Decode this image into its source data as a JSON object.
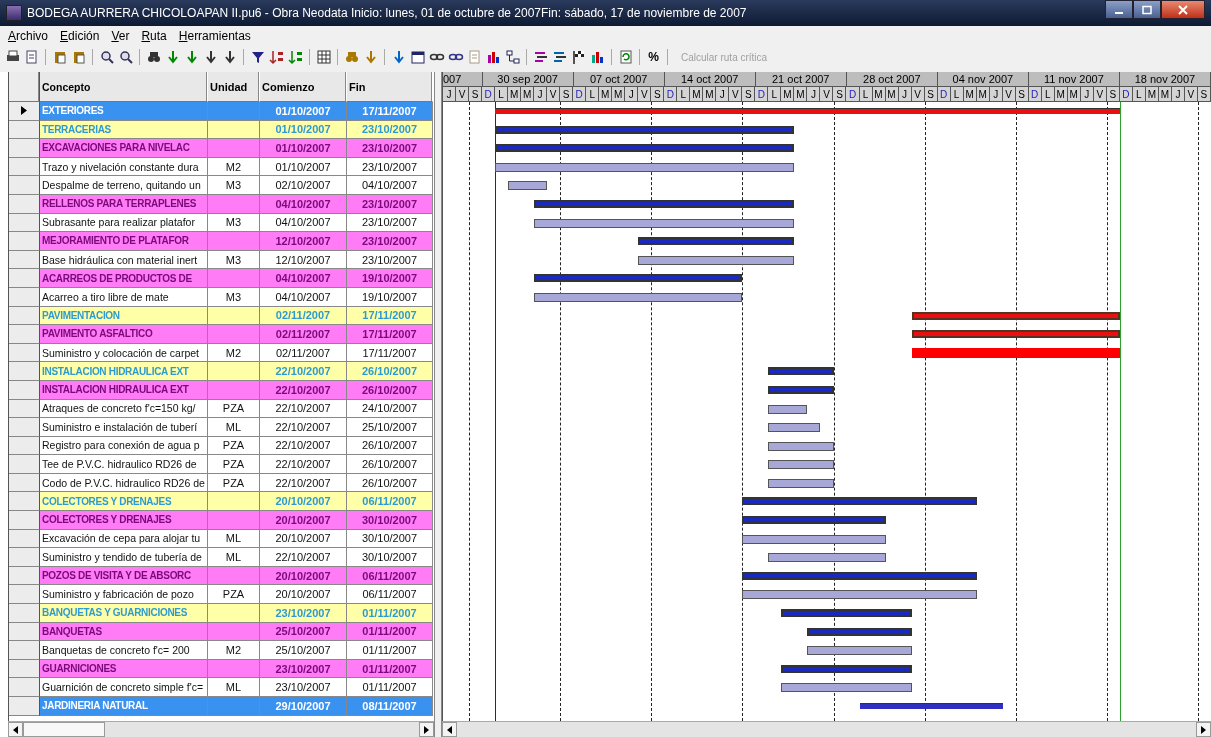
{
  "window": {
    "title": "BODEGA AURRERA CHICOLOAPAN II.pu6 - Obra Neodata Inicio: lunes, 01 de octubre de 2007Fin: sábado, 17 de noviembre de 2007"
  },
  "menu": [
    "Archivo",
    "Edición",
    "Ver",
    "Ruta",
    "Herramientas"
  ],
  "toolbar": {
    "percent": "%",
    "critical_path": {
      "label": "Calcular ruta crítica",
      "disabled": true
    }
  },
  "table": {
    "columns": [
      "Concepto",
      "Unidad",
      "Comienzo",
      "Fin"
    ],
    "rows": [
      {
        "kind": "top",
        "concept": "EXTERIORES",
        "unit": "",
        "start": "01/10/2007",
        "end": "17/11/2007",
        "critical": true,
        "selected": true
      },
      {
        "kind": "group",
        "concept": "TERRACERIAS",
        "unit": "",
        "start": "01/10/2007",
        "end": "23/10/2007",
        "critical": false,
        "selected": false
      },
      {
        "kind": "subgroup",
        "concept": "EXCAVACIONES PARA NIVELAC",
        "unit": "",
        "start": "01/10/2007",
        "end": "23/10/2007",
        "critical": false,
        "selected": false
      },
      {
        "kind": "task",
        "concept": "Trazo y nivelación constante dura",
        "unit": "M2",
        "start": "01/10/2007",
        "end": "23/10/2007",
        "critical": false,
        "selected": false
      },
      {
        "kind": "task",
        "concept": "Despalme de terreno, quitando un",
        "unit": "M3",
        "start": "02/10/2007",
        "end": "04/10/2007",
        "critical": false,
        "selected": false
      },
      {
        "kind": "subgroup",
        "concept": "RELLENOS PARA TERRAPLENES",
        "unit": "",
        "start": "04/10/2007",
        "end": "23/10/2007",
        "critical": false,
        "selected": false
      },
      {
        "kind": "task",
        "concept": "Subrasante para realizar platafor",
        "unit": "M3",
        "start": "04/10/2007",
        "end": "23/10/2007",
        "critical": false,
        "selected": false
      },
      {
        "kind": "subgroup",
        "concept": "MEJORAMIENTO DE PLATAFOR",
        "unit": "",
        "start": "12/10/2007",
        "end": "23/10/2007",
        "critical": false,
        "selected": false
      },
      {
        "kind": "task",
        "concept": " Base hidráulica con material inert",
        "unit": "M3",
        "start": "12/10/2007",
        "end": "23/10/2007",
        "critical": false,
        "selected": false
      },
      {
        "kind": "subgroup",
        "concept": "ACARREOS DE PRODUCTOS DE",
        "unit": "",
        "start": "04/10/2007",
        "end": "19/10/2007",
        "critical": false,
        "selected": false
      },
      {
        "kind": "task",
        "concept": "Acarreo a tiro libre de mate",
        "unit": "M3",
        "start": "04/10/2007",
        "end": "19/10/2007",
        "critical": false,
        "selected": false
      },
      {
        "kind": "group",
        "concept": "PAVIMENTACION",
        "unit": "",
        "start": "02/11/2007",
        "end": "17/11/2007",
        "critical": true,
        "selected": false
      },
      {
        "kind": "subgroup",
        "concept": "PAVIMENTO ASFALTICO",
        "unit": "",
        "start": "02/11/2007",
        "end": "17/11/2007",
        "critical": true,
        "selected": false
      },
      {
        "kind": "task",
        "concept": "Suministro y colocación de carpet",
        "unit": "M2",
        "start": "02/11/2007",
        "end": "17/11/2007",
        "critical": true,
        "selected": false
      },
      {
        "kind": "group",
        "concept": "INSTALACION HIDRAULICA EXT",
        "unit": "",
        "start": "22/10/2007",
        "end": "26/10/2007",
        "critical": false,
        "selected": false
      },
      {
        "kind": "subgroup",
        "concept": "INSTALACION HIDRAULICA EXT",
        "unit": "",
        "start": "22/10/2007",
        "end": "26/10/2007",
        "critical": false,
        "selected": false
      },
      {
        "kind": "task",
        "concept": "Atraques de concreto f'c=150 kg/",
        "unit": "PZA",
        "start": "22/10/2007",
        "end": "24/10/2007",
        "critical": false,
        "selected": false
      },
      {
        "kind": "task",
        "concept": " Suministro e instalación de tuberí",
        "unit": "ML",
        "start": "22/10/2007",
        "end": "25/10/2007",
        "critical": false,
        "selected": false
      },
      {
        "kind": "task",
        "concept": "Registro para conexión de agua p",
        "unit": "PZA",
        "start": "22/10/2007",
        "end": "26/10/2007",
        "critical": false,
        "selected": false
      },
      {
        "kind": "task",
        "concept": "Tee de P.V.C. hidraulico RD26 de",
        "unit": "PZA",
        "start": "22/10/2007",
        "end": "26/10/2007",
        "critical": false,
        "selected": false
      },
      {
        "kind": "task",
        "concept": "Codo de P.V.C. hidraulico RD26 de",
        "unit": "PZA",
        "start": "22/10/2007",
        "end": "26/10/2007",
        "critical": false,
        "selected": false
      },
      {
        "kind": "group",
        "concept": "COLECTORES Y DRENAJES",
        "unit": "",
        "start": "20/10/2007",
        "end": "06/11/2007",
        "critical": false,
        "selected": false
      },
      {
        "kind": "subgroup",
        "concept": "COLECTORES Y DRENAJES",
        "unit": "",
        "start": "20/10/2007",
        "end": "30/10/2007",
        "critical": false,
        "selected": false
      },
      {
        "kind": "task",
        "concept": "Excavación de cepa para alojar tu",
        "unit": "ML",
        "start": "20/10/2007",
        "end": "30/10/2007",
        "critical": false,
        "selected": false
      },
      {
        "kind": "task",
        "concept": "Suministro y tendido de tubería de",
        "unit": "ML",
        "start": "22/10/2007",
        "end": "30/10/2007",
        "critical": false,
        "selected": false
      },
      {
        "kind": "subgroup",
        "concept": "POZOS DE VISITA Y DE ABSORC",
        "unit": "",
        "start": "20/10/2007",
        "end": "06/11/2007",
        "critical": false,
        "selected": false
      },
      {
        "kind": "task",
        "concept": "Suministro y fabricación de pozo",
        "unit": "PZA",
        "start": "20/10/2007",
        "end": "06/11/2007",
        "critical": false,
        "selected": false
      },
      {
        "kind": "group",
        "concept": "BANQUETAS Y GUARNICIONES",
        "unit": "",
        "start": "23/10/2007",
        "end": "01/11/2007",
        "critical": false,
        "selected": false
      },
      {
        "kind": "subgroup",
        "concept": "BANQUETAS",
        "unit": "",
        "start": "25/10/2007",
        "end": "01/11/2007",
        "critical": false,
        "selected": false
      },
      {
        "kind": "task",
        "concept": " Banquetas de concreto f'c= 200",
        "unit": "M2",
        "start": "25/10/2007",
        "end": "01/11/2007",
        "critical": false,
        "selected": false
      },
      {
        "kind": "subgroup",
        "concept": "GUARNICIONES",
        "unit": "",
        "start": "23/10/2007",
        "end": "01/11/2007",
        "critical": false,
        "selected": false
      },
      {
        "kind": "task",
        "concept": "Guarnición de concreto simple f'c=",
        "unit": "ML",
        "start": "23/10/2007",
        "end": "01/11/2007",
        "critical": false,
        "selected": false
      },
      {
        "kind": "top",
        "concept": "JARDINERIA NATURAL",
        "unit": "",
        "start": "29/10/2007",
        "end": "08/11/2007",
        "critical": false,
        "selected": false
      }
    ]
  },
  "gantt": {
    "partial_week": "007",
    "weeks": [
      "30 sep 2007",
      "07 oct 2007",
      "14 oct 2007",
      "21 oct 2007",
      "28 oct 2007",
      "04 nov 2007",
      "11 nov 2007",
      "18 nov 2007"
    ],
    "days": [
      "J",
      "V",
      "S",
      "D",
      "L",
      "M",
      "M",
      "J",
      "V",
      "S",
      "D",
      "L",
      "M",
      "M",
      "J",
      "V",
      "S",
      "D",
      "L",
      "M",
      "M",
      "J",
      "V",
      "S",
      "D",
      "L",
      "M",
      "M",
      "J",
      "V",
      "S",
      "D",
      "L",
      "M",
      "M",
      "J",
      "V",
      "S",
      "D",
      "L",
      "M",
      "M",
      "J",
      "V",
      "S",
      "D",
      "L",
      "M",
      "M",
      "J",
      "V",
      "S",
      "D",
      "L",
      "M",
      "M",
      "J",
      "V",
      "S"
    ]
  }
}
